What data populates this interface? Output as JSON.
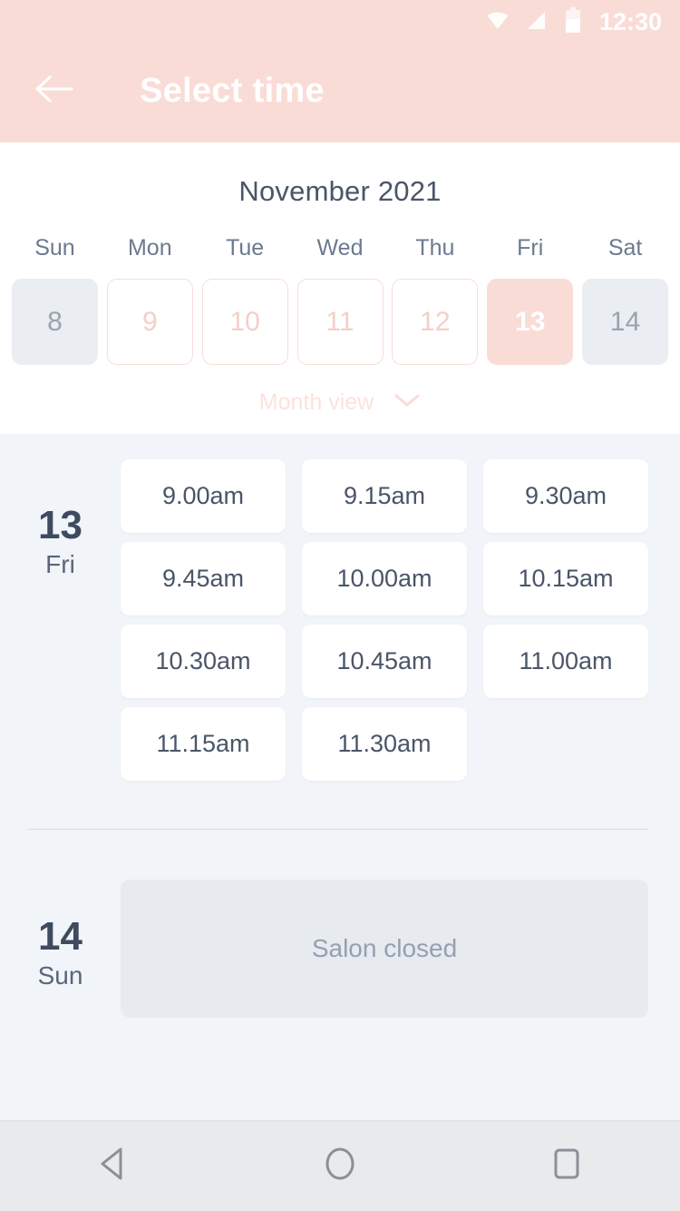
{
  "status_bar": {
    "clock": "12:30",
    "icons": [
      "wifi-icon",
      "signal-icon",
      "battery-icon"
    ]
  },
  "app_bar": {
    "back_icon": "arrow-left-icon",
    "title": "Select time"
  },
  "calendar": {
    "month_label": "November 2021",
    "weekdays": [
      "Sun",
      "Mon",
      "Tue",
      "Wed",
      "Thu",
      "Fri",
      "Sat"
    ],
    "days": [
      {
        "number": "8",
        "state": "disabled"
      },
      {
        "number": "9",
        "state": "available"
      },
      {
        "number": "10",
        "state": "available"
      },
      {
        "number": "11",
        "state": "available"
      },
      {
        "number": "12",
        "state": "available"
      },
      {
        "number": "13",
        "state": "selected"
      },
      {
        "number": "14",
        "state": "disabled"
      }
    ],
    "view_toggle": {
      "label": "Month view",
      "icon": "chevron-down-icon"
    }
  },
  "schedule": {
    "days": [
      {
        "date_number": "13",
        "day_of_week": "Fri",
        "slots": [
          "9.00am",
          "9.15am",
          "9.30am",
          "9.45am",
          "10.00am",
          "10.15am",
          "10.30am",
          "10.45am",
          "11.00am",
          "11.15am",
          "11.30am"
        ]
      },
      {
        "date_number": "14",
        "day_of_week": "Sun",
        "closed_message": "Salon closed"
      }
    ]
  },
  "nav_bar": {
    "back": "back-triangle-icon",
    "home": "home-circle-icon",
    "recents": "recents-square-icon"
  },
  "colors": {
    "brand_pink": "#fadcd7",
    "slot_bg": "#f1f4f9",
    "text_dark": "#3e4a5e",
    "disabled_bg": "#eaeef3"
  }
}
